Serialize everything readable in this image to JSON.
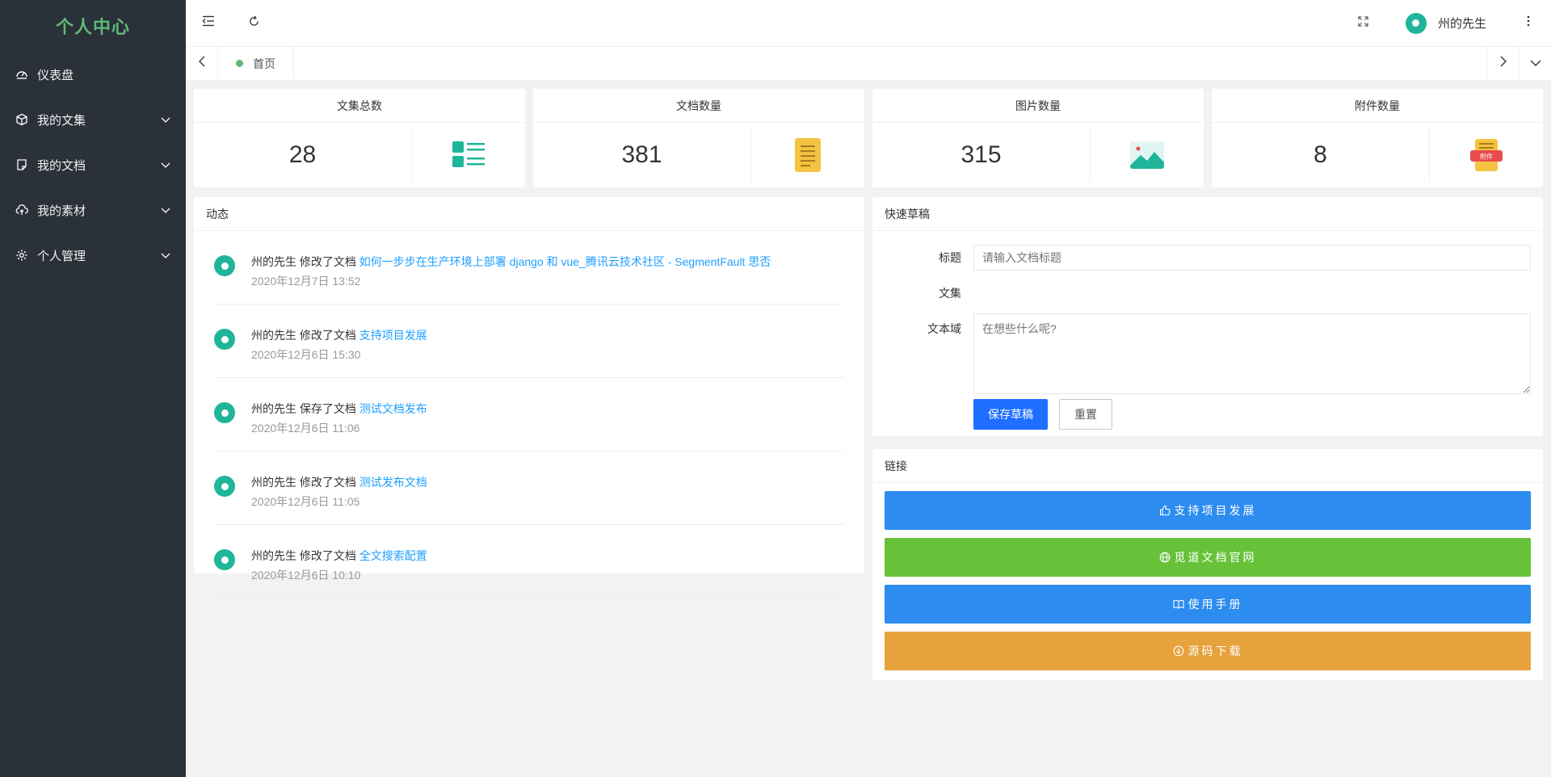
{
  "sidebar": {
    "logo": "个人中心",
    "items": [
      {
        "label": "仪表盘",
        "icon": "dashboard-icon",
        "has_children": false
      },
      {
        "label": "我的文集",
        "icon": "cube-icon",
        "has_children": true
      },
      {
        "label": "我的文档",
        "icon": "document-icon",
        "has_children": true
      },
      {
        "label": "我的素材",
        "icon": "cloud-upload-icon",
        "has_children": true
      },
      {
        "label": "个人管理",
        "icon": "gear-icon",
        "has_children": true
      }
    ]
  },
  "header": {
    "user_name": "州的先生"
  },
  "tabs": [
    {
      "label": "首页"
    }
  ],
  "stats": [
    {
      "title": "文集总数",
      "value": "28",
      "icon": "list-icon"
    },
    {
      "title": "文档数量",
      "value": "381",
      "icon": "document-yellow-icon"
    },
    {
      "title": "图片数量",
      "value": "315",
      "icon": "image-icon"
    },
    {
      "title": "附件数量",
      "value": "8",
      "icon": "attachment-icon",
      "icon_label": "附件"
    }
  ],
  "activity": {
    "title": "动态",
    "items": [
      {
        "user": "州的先生",
        "action": "修改了文档",
        "link": "如何一步步在生产环境上部署 django 和 vue_腾讯云技术社区 - SegmentFault 思否",
        "time": "2020年12月7日 13:52"
      },
      {
        "user": "州的先生",
        "action": "修改了文档",
        "link": "支持项目发展",
        "time": "2020年12月6日 15:30"
      },
      {
        "user": "州的先生",
        "action": "保存了文档",
        "link": "测试文档发布",
        "time": "2020年12月6日 11:06"
      },
      {
        "user": "州的先生",
        "action": "修改了文档",
        "link": "测试发布文档",
        "time": "2020年12月6日 11:05"
      },
      {
        "user": "州的先生",
        "action": "修改了文档",
        "link": "全文搜索配置",
        "time": "2020年12月6日 10:10"
      }
    ]
  },
  "draft": {
    "title": "快速草稿",
    "title_label": "标题",
    "title_placeholder": "请输入文档标题",
    "collection_label": "文集",
    "body_label": "文本域",
    "body_placeholder": "在想些什么呢?",
    "save_label": "保存草稿",
    "reset_label": "重置"
  },
  "links": {
    "title": "链接",
    "buttons": [
      {
        "label": "支持项目发展",
        "icon": "thumbs-up-icon",
        "color": "#2d8cf0"
      },
      {
        "label": "觅道文档官网",
        "icon": "globe-icon",
        "color": "#67c23a"
      },
      {
        "label": "使用手册",
        "icon": "book-icon",
        "color": "#2d8cf0"
      },
      {
        "label": "源码下载",
        "icon": "download-icon",
        "color": "#e6a23c"
      }
    ]
  },
  "colors": {
    "sidebar_bg": "#2a3139",
    "logo": "#5fb878",
    "accent_teal": "#1fb59a",
    "link_blue": "#1e9fff",
    "primary_button": "#1e6fff"
  }
}
